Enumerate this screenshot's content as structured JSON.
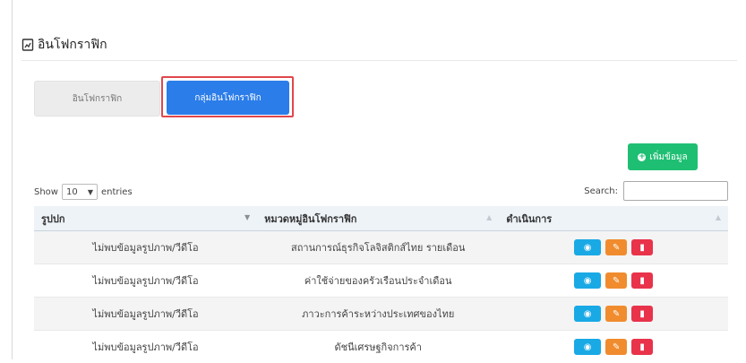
{
  "header": {
    "title": "อินโฟกราฟิก"
  },
  "tabs": [
    {
      "label": "อินโฟกราฟิก",
      "active": false
    },
    {
      "label": "กลุ่มอินโฟกราฟิก",
      "active": true
    }
  ],
  "toolbar": {
    "add_label": "เพิ่มข้อมูล"
  },
  "datatable": {
    "show_label": "Show",
    "page_length": "10",
    "entries_label": "entries",
    "search_label": "Search:",
    "columns": [
      "รูปปก",
      "หมวดหมู่อินโฟกราฟิก",
      "ดำเนินการ"
    ],
    "rows": [
      {
        "cover": "ไม่พบข้อมูลรูปภาพ/วีดีโอ",
        "category": "สถานการณ์ธุรกิจโลจิสติกส์ไทย รายเดือน"
      },
      {
        "cover": "ไม่พบข้อมูลรูปภาพ/วีดีโอ",
        "category": "ค่าใช้จ่ายของครัวเรือนประจำเดือน"
      },
      {
        "cover": "ไม่พบข้อมูลรูปภาพ/วีดีโอ",
        "category": "ภาวะการค้าระหว่างประเทศของไทย"
      },
      {
        "cover": "ไม่พบข้อมูลรูปภาพ/วีดีโอ",
        "category": "ดัชนีเศรษฐกิจการค้า"
      }
    ]
  },
  "colors": {
    "primary": "#2b7de9",
    "success": "#1fbf73",
    "info": "#19a9e5",
    "warning": "#f08c2e",
    "danger": "#e8334a",
    "highlight": "#e0474c"
  }
}
